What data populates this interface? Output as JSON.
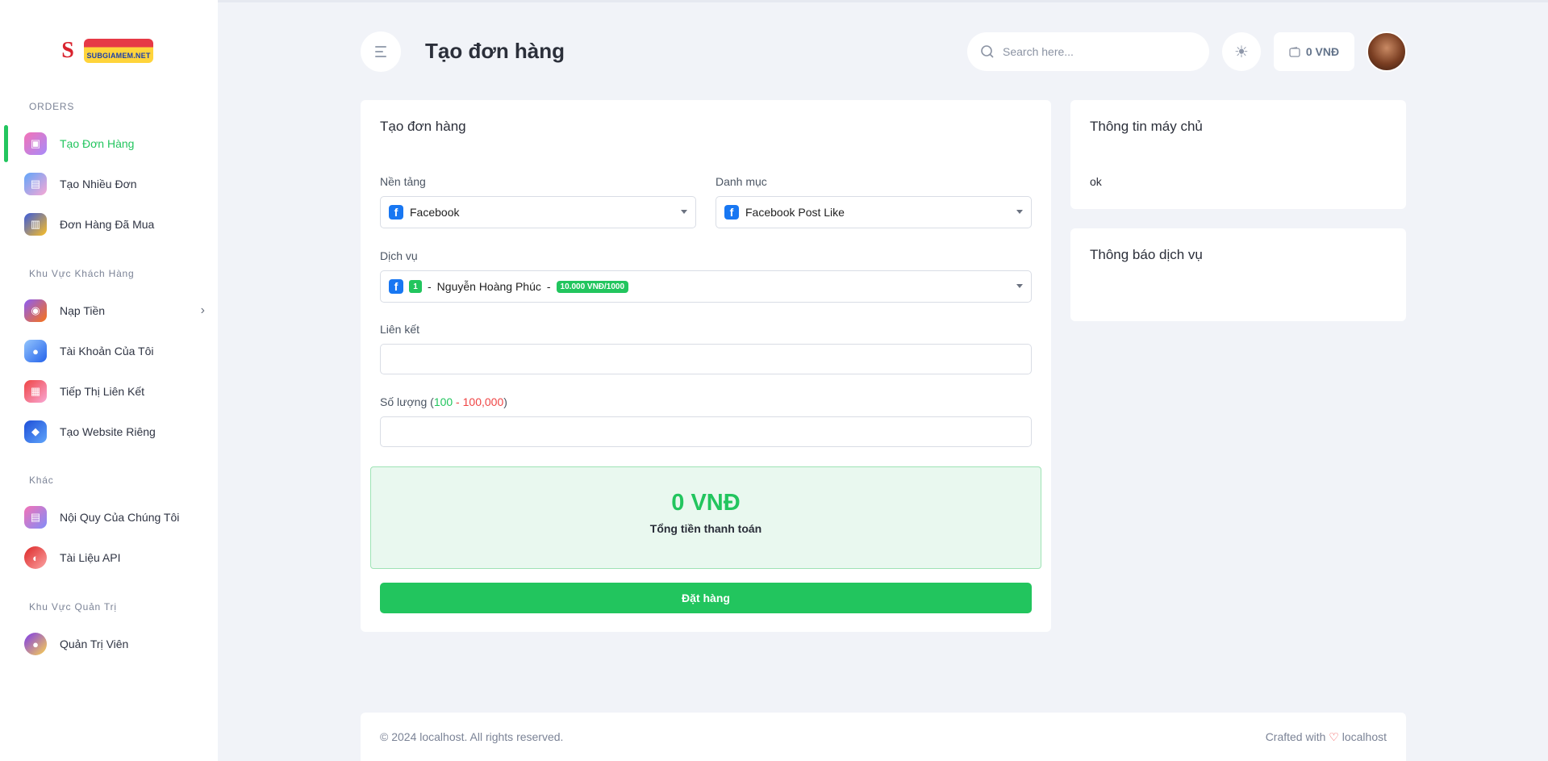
{
  "brand": {
    "logo_text": "SUBGIAMEM.NET"
  },
  "sidebar": {
    "sections": [
      {
        "title": "ORDERS"
      },
      {
        "title": "Khu Vực Khách Hàng"
      },
      {
        "title": "Khác"
      },
      {
        "title": "Khu Vực Quản Trị"
      }
    ],
    "items": [
      {
        "label": "Tạo Đơn Hàng",
        "icon": "cart-icon"
      },
      {
        "label": "Tạo Nhiều Đơn",
        "icon": "tv-icon"
      },
      {
        "label": "Đơn Hàng Đã Mua",
        "icon": "shop-icon"
      },
      {
        "label": "Nạp Tiền",
        "icon": "wallet-icon"
      },
      {
        "label": "Tài Khoản Của Tôi",
        "icon": "user-icon"
      },
      {
        "label": "Tiếp Thị Liên Kết",
        "icon": "calendar-icon"
      },
      {
        "label": "Tạo Website Riêng",
        "icon": "box-icon"
      },
      {
        "label": "Nội Quy Của Chúng Tôi",
        "icon": "rules-icon"
      },
      {
        "label": "Tài Liệu API",
        "icon": "api-icon"
      },
      {
        "label": "Quản Trị Viên",
        "icon": "admin-icon"
      }
    ]
  },
  "header": {
    "title": "Tạo đơn hàng",
    "search_placeholder": "Search here...",
    "balance": "0 VNĐ"
  },
  "form": {
    "card_title": "Tạo đơn hàng",
    "platform_label": "Nền tảng",
    "platform_value": "Facebook",
    "category_label": "Danh mục",
    "category_value": "Facebook Post Like",
    "service_label": "Dịch vụ",
    "service_number": "1",
    "service_sep": "-",
    "service_name": "Nguyễn Hoàng Phúc",
    "service_price": "10.000 VNĐ/1000",
    "link_label": "Liên kết",
    "link_value": "",
    "quantity_label_prefix": "Số lượng (",
    "quantity_min": "100",
    "quantity_sep": " - ",
    "quantity_max": "100,000",
    "quantity_label_suffix": ")",
    "quantity_value": "",
    "total_amount": "0 VNĐ",
    "total_caption": "Tổng tiền thanh toán",
    "submit_label": "Đặt hàng"
  },
  "server_info": {
    "title": "Thông tin máy chủ",
    "content": "ok"
  },
  "service_notice": {
    "title": "Thông báo dịch vụ"
  },
  "footer": {
    "copyright": "© 2024 localhost. All rights reserved.",
    "crafted_prefix": "Crafted with",
    "crafted_suffix": "localhost"
  },
  "colors": {
    "accent": "#22c55e",
    "danger": "#ef4444",
    "facebook": "#1877f2"
  }
}
